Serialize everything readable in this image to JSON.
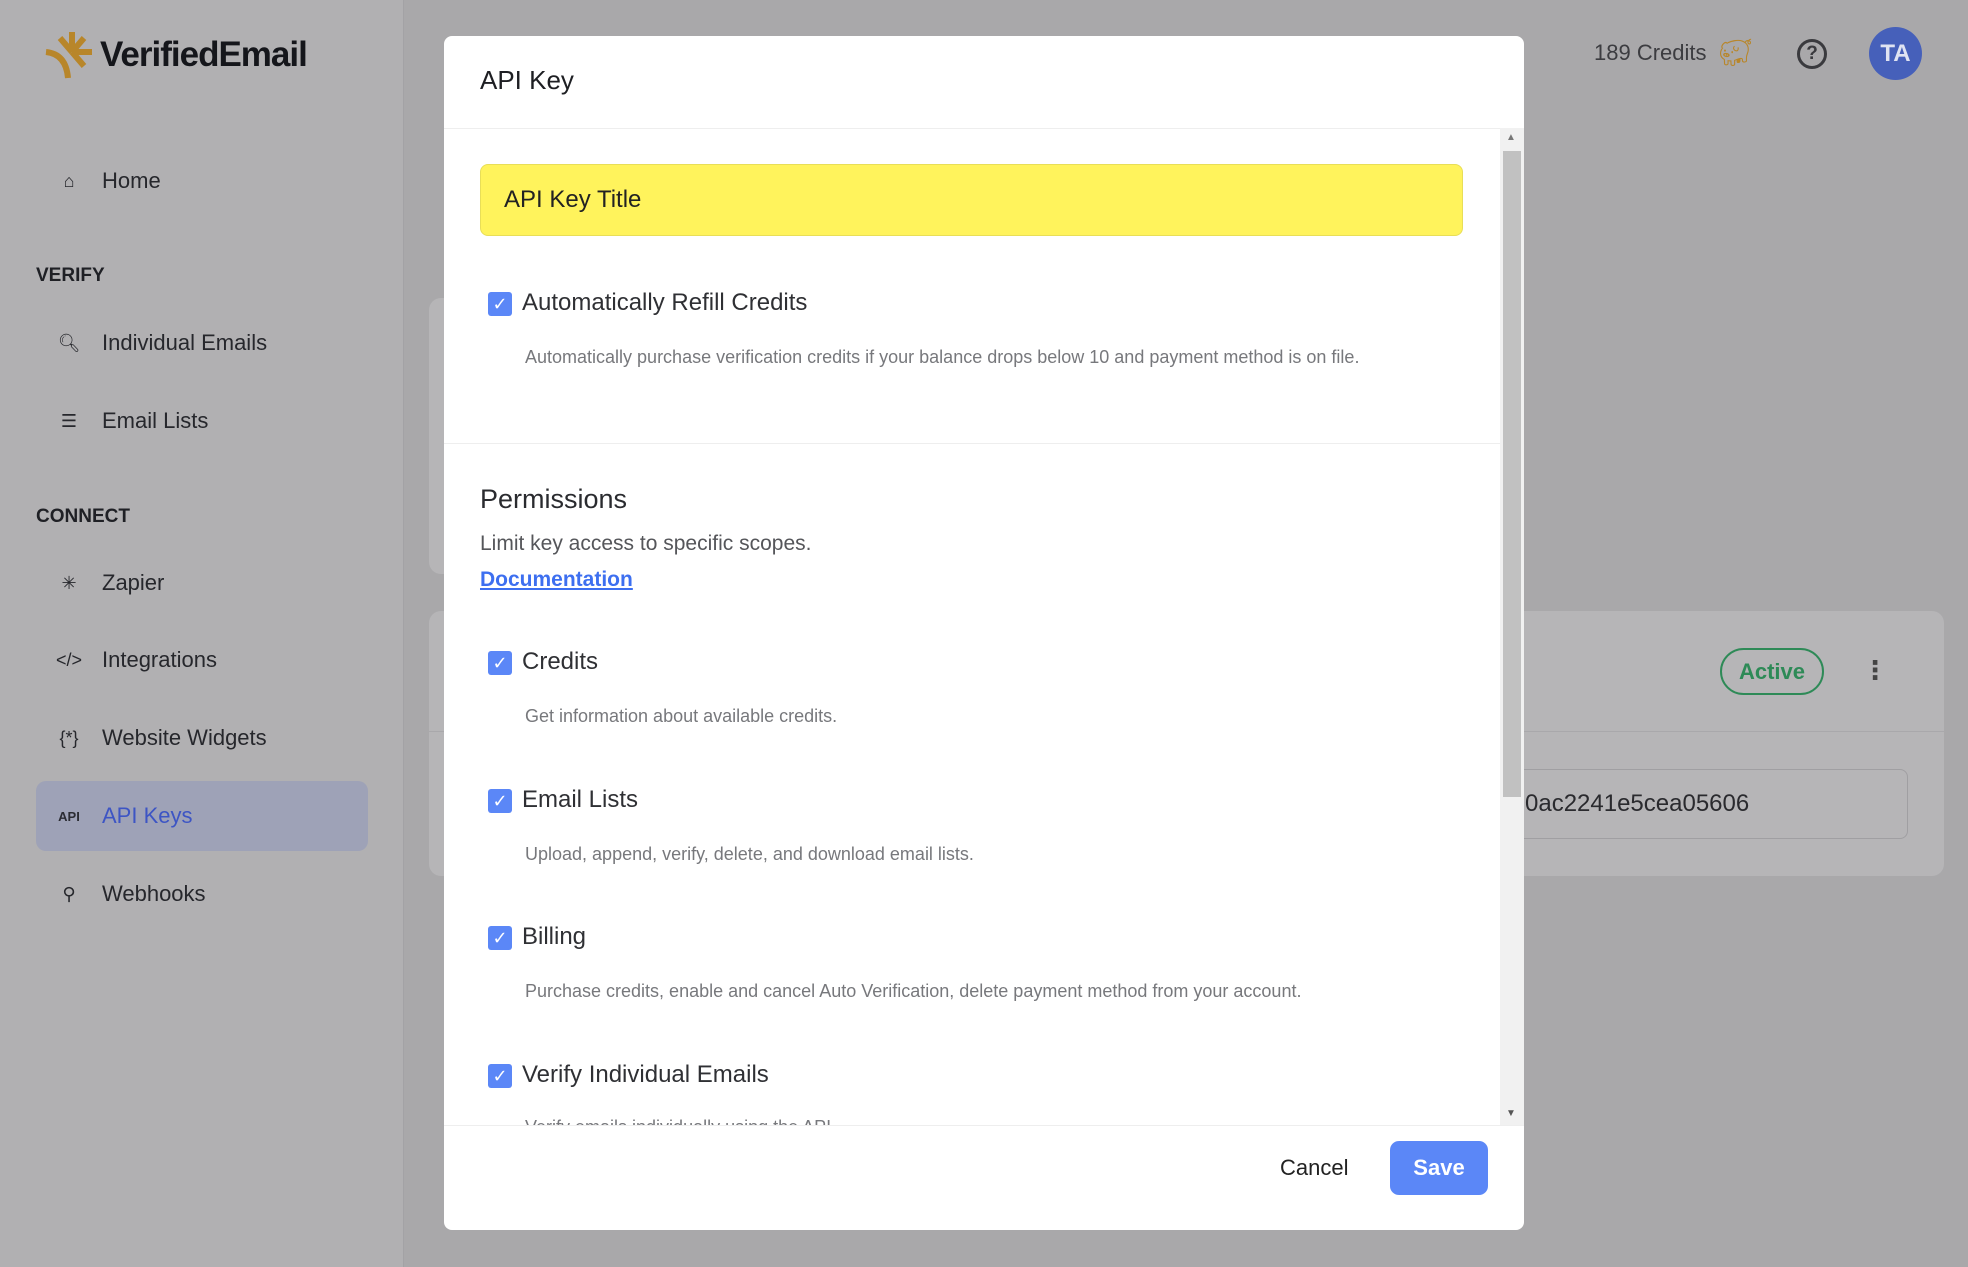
{
  "brand": {
    "name": "VerifiedEmail",
    "accent": "#b8862a"
  },
  "sidebar": {
    "home": "Home",
    "sections": [
      {
        "title": "VERIFY",
        "items": [
          {
            "label": "Individual Emails",
            "icon": "search-icon"
          },
          {
            "label": "Email Lists",
            "icon": "list-icon"
          }
        ]
      },
      {
        "title": "CONNECT",
        "items": [
          {
            "label": "Zapier",
            "icon": "asterisk-icon"
          },
          {
            "label": "Integrations",
            "icon": "code-icon"
          },
          {
            "label": "Website Widgets",
            "icon": "braces-icon"
          },
          {
            "label": "API Keys",
            "icon": "api-icon",
            "icon_text": "API",
            "active": true
          },
          {
            "label": "Webhooks",
            "icon": "webhook-icon"
          }
        ]
      }
    ]
  },
  "topbar": {
    "credits": "189 Credits",
    "avatar": "TA"
  },
  "background": {
    "status": "Active",
    "key_fragment": "0ac2241e5cea05606"
  },
  "modal": {
    "title": "API Key",
    "title_input_value": "API Key Title",
    "auto_refill": {
      "label": "Automatically Refill Credits",
      "checked": true,
      "description": "Automatically purchase verification credits if your balance drops below 10 and payment method is on file."
    },
    "permissions": {
      "heading": "Permissions",
      "subtitle": "Limit key access to specific scopes.",
      "link": "Documentation",
      "items": [
        {
          "label": "Credits",
          "checked": true,
          "description": "Get information about available credits."
        },
        {
          "label": "Email Lists",
          "checked": true,
          "description": "Upload, append, verify, delete, and download email lists."
        },
        {
          "label": "Billing",
          "checked": true,
          "description": "Purchase credits, enable and cancel Auto Verification, delete payment method from your account."
        },
        {
          "label": "Verify Individual Emails",
          "checked": true,
          "description": "Verify emails individually using the API"
        }
      ]
    },
    "cancel": "Cancel",
    "save": "Save"
  },
  "colors": {
    "primary": "#5b87f7",
    "active_green": "#2e8a57",
    "input_highlight": "#fff35c"
  }
}
